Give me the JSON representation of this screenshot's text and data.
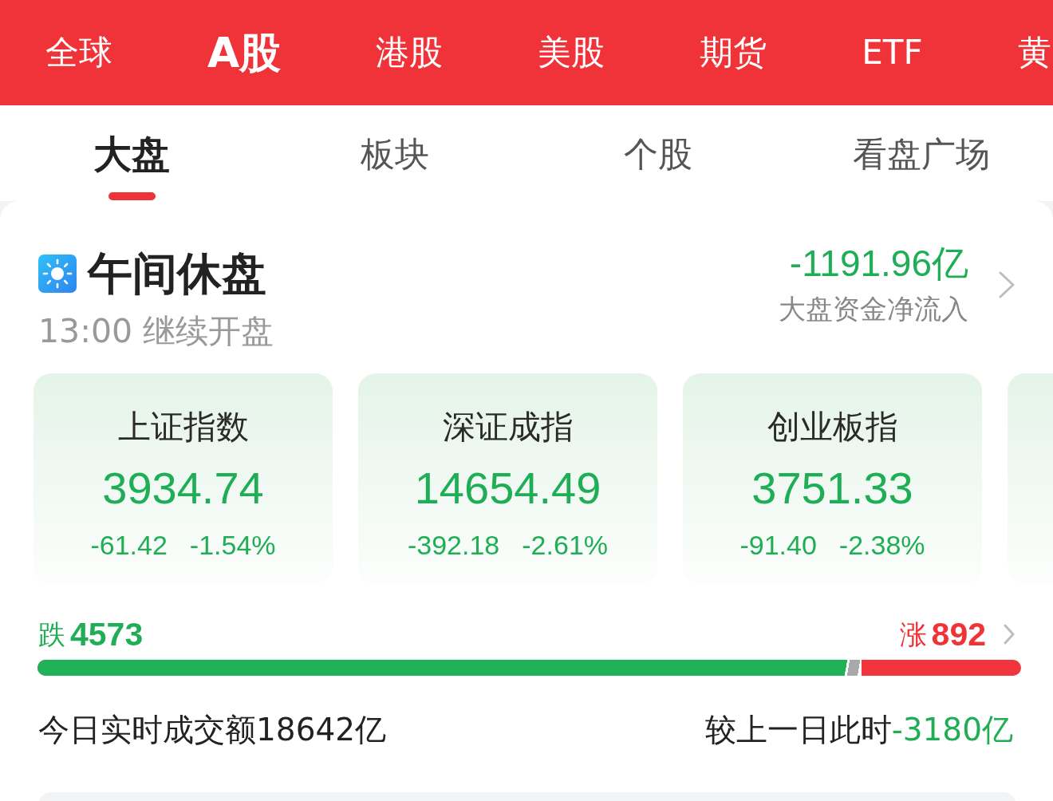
{
  "market_tabs": [
    {
      "label": "全球",
      "selected": false
    },
    {
      "label": "A股",
      "selected": true
    },
    {
      "label": "港股",
      "selected": false
    },
    {
      "label": "美股",
      "selected": false
    },
    {
      "label": "期货",
      "selected": false
    },
    {
      "label": "ETF",
      "selected": false
    },
    {
      "label": "黄",
      "selected": false
    }
  ],
  "view_tabs": [
    {
      "label": "大盘",
      "selected": true
    },
    {
      "label": "板块",
      "selected": false
    },
    {
      "label": "个股",
      "selected": false
    },
    {
      "label": "看盘广场",
      "selected": false
    }
  ],
  "session": {
    "title": "午间休盘",
    "resume_note": "13:00 继续开盘"
  },
  "capital_flow": {
    "value": "-1191.96亿",
    "label": "大盘资金净流入"
  },
  "index_carousel": {
    "cards": [
      {
        "name": "上证指数",
        "value": "3934.74",
        "change": "-61.42",
        "change_pct": "-1.54%"
      },
      {
        "name": "深证成指",
        "value": "14654.49",
        "change": "-392.18",
        "change_pct": "-2.61%"
      },
      {
        "name": "创业板指",
        "value": "3751.33",
        "change": "-91.40",
        "change_pct": "-2.38%"
      }
    ],
    "next_card_peek": true
  },
  "breadth": {
    "fall_label": "跌",
    "fall_count": "4573",
    "rise_label": "涨",
    "rise_count": "892",
    "bar": {
      "level": 0.838
    }
  },
  "turnover": {
    "text": "今日实时成交额18642亿",
    "compare_label": "较上一日此时",
    "compare_value": "-3180亿"
  },
  "lower_panel_peek": true
}
